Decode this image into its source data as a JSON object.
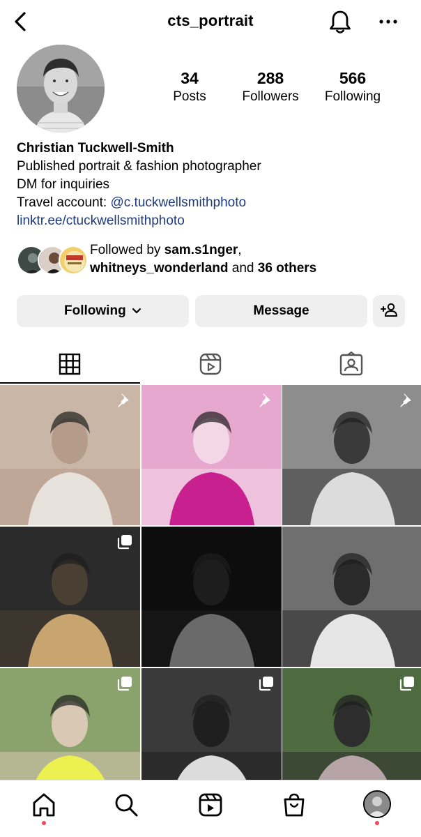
{
  "header": {
    "username": "cts_portrait",
    "back_icon": "chevron-left-icon",
    "notifications_icon": "bell-icon",
    "more_icon": "ellipsis-icon"
  },
  "stats": {
    "posts": {
      "value": "34",
      "label": "Posts"
    },
    "followers": {
      "value": "288",
      "label": "Followers"
    },
    "following": {
      "value": "566",
      "label": "Following"
    }
  },
  "bio": {
    "name": "Christian Tuckwell-Smith",
    "line1": "Published portrait & fashion photographer",
    "line2": "DM for inquiries",
    "line3_prefix": "Travel account: ",
    "line3_handle": "@c.tuckwellsmithphoto",
    "link": "linktr.ee/ctuckwellsmithphoto"
  },
  "followed_by": {
    "prefix": "Followed by ",
    "user1": "sam.s1nger",
    "separator": ",",
    "user2": "whitneys_wonderland",
    "middle": " and ",
    "others": "36 others"
  },
  "actions": {
    "following_label": "Following",
    "message_label": "Message",
    "add_person_icon": "add-person-icon"
  },
  "tabs": [
    {
      "name": "posts",
      "icon": "grid-icon",
      "active": true
    },
    {
      "name": "reels",
      "icon": "reels-icon",
      "active": false
    },
    {
      "name": "tagged",
      "icon": "tagged-person-icon",
      "active": false
    }
  ],
  "posts": [
    {
      "badge": "pin-icon",
      "palette": [
        "#c9b6a6",
        "#e8e2dc",
        "#b59b8a"
      ]
    },
    {
      "badge": "pin-icon",
      "palette": [
        "#e7a8cf",
        "#c8208f",
        "#f4d7e7"
      ]
    },
    {
      "badge": "pin-icon",
      "palette": [
        "#8d8d8d",
        "#dcdcdc",
        "#3a3a3a"
      ]
    },
    {
      "badge": "multiple-photos-icon",
      "palette": [
        "#2b2b2b",
        "#c8a56e",
        "#4a3f33"
      ]
    },
    {
      "badge": "",
      "palette": [
        "#0d0d0d",
        "#6a6a6a",
        "#1d1d1d"
      ]
    },
    {
      "badge": "",
      "palette": [
        "#6f6f6f",
        "#e6e6e6",
        "#2a2a2a"
      ]
    },
    {
      "badge": "multiple-photos-icon",
      "palette": [
        "#8aa36c",
        "#ecf050",
        "#d9c8b4"
      ]
    },
    {
      "badge": "multiple-photos-icon",
      "palette": [
        "#3a3a3a",
        "#dcdcdc",
        "#1f1f1f"
      ]
    },
    {
      "badge": "multiple-photos-icon",
      "palette": [
        "#4e6a3f",
        "#b7a4a7",
        "#2d2d2d"
      ]
    }
  ],
  "bottom_nav": [
    {
      "name": "home",
      "icon": "home-icon",
      "dot": true
    },
    {
      "name": "search",
      "icon": "search-icon",
      "dot": false
    },
    {
      "name": "reels",
      "icon": "reels-icon",
      "dot": false
    },
    {
      "name": "shop",
      "icon": "shopping-bag-icon",
      "dot": false
    },
    {
      "name": "profile",
      "icon": "profile-avatar",
      "dot": true
    }
  ],
  "colors": {
    "link": "#1e3a7a",
    "button_bg": "#efefef",
    "notification_dot": "#ed4956"
  }
}
